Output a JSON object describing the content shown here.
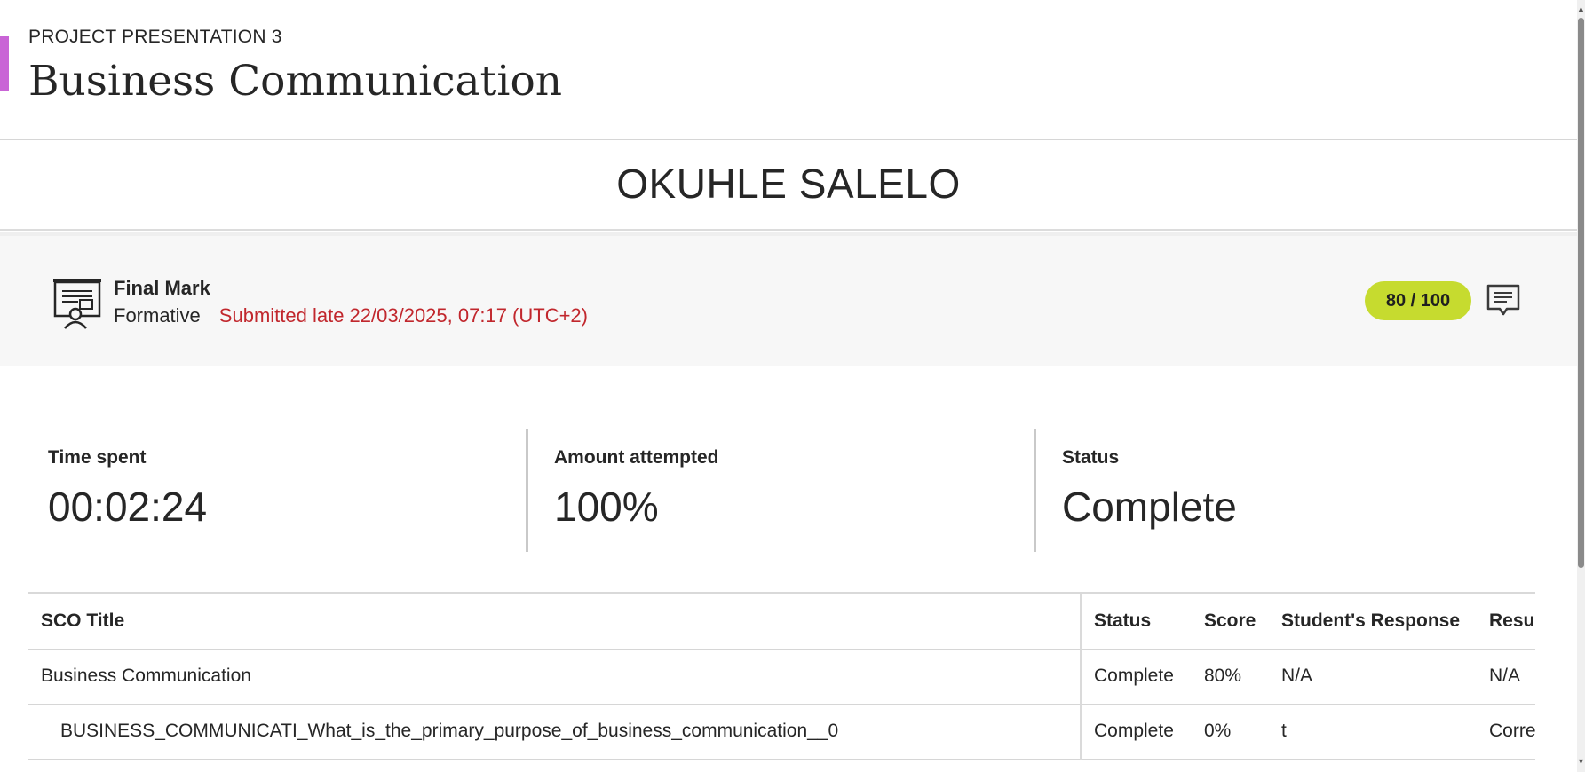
{
  "colors": {
    "accent": "#c964d6",
    "score_pill": "#c6db2f",
    "late": "#c1272d"
  },
  "header": {
    "kicker": "PROJECT PRESENTATION 3",
    "title": "Business Communication"
  },
  "student": {
    "name": "OKUHLE SALELO"
  },
  "grade": {
    "icon": "presentation-icon",
    "label": "Final Mark",
    "type": "Formative",
    "submission": "Submitted late 22/03/2025, 07:17 (UTC+2)",
    "score": "80 / 100",
    "feedback_icon": "comment-icon"
  },
  "stats": [
    {
      "label": "Time spent",
      "value": "00:02:24"
    },
    {
      "label": "Amount attempted",
      "value": "100%"
    },
    {
      "label": "Status",
      "value": "Complete"
    }
  ],
  "table": {
    "headers": [
      "SCO Title",
      "Status",
      "Score",
      "Student's Response",
      "Result"
    ],
    "rows": [
      [
        "Business Communication",
        "Complete",
        "80%",
        "N/A",
        "N/A"
      ],
      [
        "BUSINESS_COMMUNICATI_What_is_the_primary_purpose_of_business_communication__0",
        "Complete",
        "0%",
        "t",
        "Correct"
      ]
    ]
  }
}
